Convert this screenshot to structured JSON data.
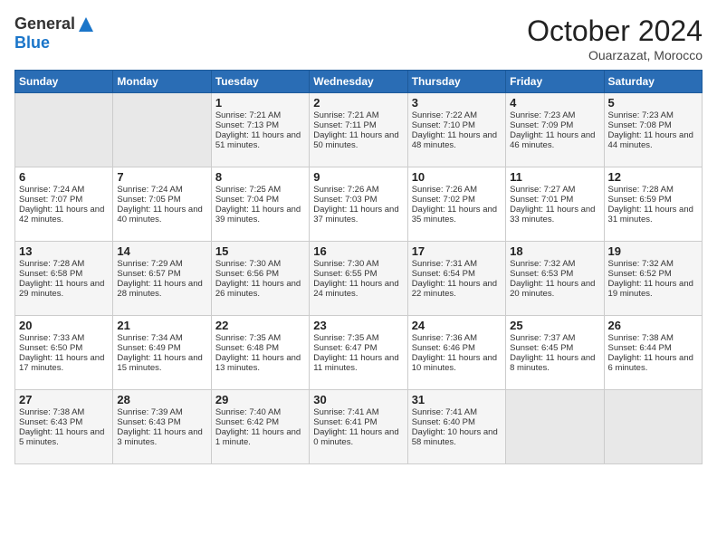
{
  "header": {
    "logo_general": "General",
    "logo_blue": "Blue",
    "month": "October 2024",
    "location": "Ouarzazat, Morocco"
  },
  "weekdays": [
    "Sunday",
    "Monday",
    "Tuesday",
    "Wednesday",
    "Thursday",
    "Friday",
    "Saturday"
  ],
  "weeks": [
    [
      {
        "day": "",
        "sunrise": "",
        "sunset": "",
        "daylight": "",
        "empty": true
      },
      {
        "day": "",
        "sunrise": "",
        "sunset": "",
        "daylight": "",
        "empty": true
      },
      {
        "day": "1",
        "sunrise": "Sunrise: 7:21 AM",
        "sunset": "Sunset: 7:13 PM",
        "daylight": "Daylight: 11 hours and 51 minutes."
      },
      {
        "day": "2",
        "sunrise": "Sunrise: 7:21 AM",
        "sunset": "Sunset: 7:11 PM",
        "daylight": "Daylight: 11 hours and 50 minutes."
      },
      {
        "day": "3",
        "sunrise": "Sunrise: 7:22 AM",
        "sunset": "Sunset: 7:10 PM",
        "daylight": "Daylight: 11 hours and 48 minutes."
      },
      {
        "day": "4",
        "sunrise": "Sunrise: 7:23 AM",
        "sunset": "Sunset: 7:09 PM",
        "daylight": "Daylight: 11 hours and 46 minutes."
      },
      {
        "day": "5",
        "sunrise": "Sunrise: 7:23 AM",
        "sunset": "Sunset: 7:08 PM",
        "daylight": "Daylight: 11 hours and 44 minutes."
      }
    ],
    [
      {
        "day": "6",
        "sunrise": "Sunrise: 7:24 AM",
        "sunset": "Sunset: 7:07 PM",
        "daylight": "Daylight: 11 hours and 42 minutes."
      },
      {
        "day": "7",
        "sunrise": "Sunrise: 7:24 AM",
        "sunset": "Sunset: 7:05 PM",
        "daylight": "Daylight: 11 hours and 40 minutes."
      },
      {
        "day": "8",
        "sunrise": "Sunrise: 7:25 AM",
        "sunset": "Sunset: 7:04 PM",
        "daylight": "Daylight: 11 hours and 39 minutes."
      },
      {
        "day": "9",
        "sunrise": "Sunrise: 7:26 AM",
        "sunset": "Sunset: 7:03 PM",
        "daylight": "Daylight: 11 hours and 37 minutes."
      },
      {
        "day": "10",
        "sunrise": "Sunrise: 7:26 AM",
        "sunset": "Sunset: 7:02 PM",
        "daylight": "Daylight: 11 hours and 35 minutes."
      },
      {
        "day": "11",
        "sunrise": "Sunrise: 7:27 AM",
        "sunset": "Sunset: 7:01 PM",
        "daylight": "Daylight: 11 hours and 33 minutes."
      },
      {
        "day": "12",
        "sunrise": "Sunrise: 7:28 AM",
        "sunset": "Sunset: 6:59 PM",
        "daylight": "Daylight: 11 hours and 31 minutes."
      }
    ],
    [
      {
        "day": "13",
        "sunrise": "Sunrise: 7:28 AM",
        "sunset": "Sunset: 6:58 PM",
        "daylight": "Daylight: 11 hours and 29 minutes."
      },
      {
        "day": "14",
        "sunrise": "Sunrise: 7:29 AM",
        "sunset": "Sunset: 6:57 PM",
        "daylight": "Daylight: 11 hours and 28 minutes."
      },
      {
        "day": "15",
        "sunrise": "Sunrise: 7:30 AM",
        "sunset": "Sunset: 6:56 PM",
        "daylight": "Daylight: 11 hours and 26 minutes."
      },
      {
        "day": "16",
        "sunrise": "Sunrise: 7:30 AM",
        "sunset": "Sunset: 6:55 PM",
        "daylight": "Daylight: 11 hours and 24 minutes."
      },
      {
        "day": "17",
        "sunrise": "Sunrise: 7:31 AM",
        "sunset": "Sunset: 6:54 PM",
        "daylight": "Daylight: 11 hours and 22 minutes."
      },
      {
        "day": "18",
        "sunrise": "Sunrise: 7:32 AM",
        "sunset": "Sunset: 6:53 PM",
        "daylight": "Daylight: 11 hours and 20 minutes."
      },
      {
        "day": "19",
        "sunrise": "Sunrise: 7:32 AM",
        "sunset": "Sunset: 6:52 PM",
        "daylight": "Daylight: 11 hours and 19 minutes."
      }
    ],
    [
      {
        "day": "20",
        "sunrise": "Sunrise: 7:33 AM",
        "sunset": "Sunset: 6:50 PM",
        "daylight": "Daylight: 11 hours and 17 minutes."
      },
      {
        "day": "21",
        "sunrise": "Sunrise: 7:34 AM",
        "sunset": "Sunset: 6:49 PM",
        "daylight": "Daylight: 11 hours and 15 minutes."
      },
      {
        "day": "22",
        "sunrise": "Sunrise: 7:35 AM",
        "sunset": "Sunset: 6:48 PM",
        "daylight": "Daylight: 11 hours and 13 minutes."
      },
      {
        "day": "23",
        "sunrise": "Sunrise: 7:35 AM",
        "sunset": "Sunset: 6:47 PM",
        "daylight": "Daylight: 11 hours and 11 minutes."
      },
      {
        "day": "24",
        "sunrise": "Sunrise: 7:36 AM",
        "sunset": "Sunset: 6:46 PM",
        "daylight": "Daylight: 11 hours and 10 minutes."
      },
      {
        "day": "25",
        "sunrise": "Sunrise: 7:37 AM",
        "sunset": "Sunset: 6:45 PM",
        "daylight": "Daylight: 11 hours and 8 minutes."
      },
      {
        "day": "26",
        "sunrise": "Sunrise: 7:38 AM",
        "sunset": "Sunset: 6:44 PM",
        "daylight": "Daylight: 11 hours and 6 minutes."
      }
    ],
    [
      {
        "day": "27",
        "sunrise": "Sunrise: 7:38 AM",
        "sunset": "Sunset: 6:43 PM",
        "daylight": "Daylight: 11 hours and 5 minutes."
      },
      {
        "day": "28",
        "sunrise": "Sunrise: 7:39 AM",
        "sunset": "Sunset: 6:43 PM",
        "daylight": "Daylight: 11 hours and 3 minutes."
      },
      {
        "day": "29",
        "sunrise": "Sunrise: 7:40 AM",
        "sunset": "Sunset: 6:42 PM",
        "daylight": "Daylight: 11 hours and 1 minute."
      },
      {
        "day": "30",
        "sunrise": "Sunrise: 7:41 AM",
        "sunset": "Sunset: 6:41 PM",
        "daylight": "Daylight: 11 hours and 0 minutes."
      },
      {
        "day": "31",
        "sunrise": "Sunrise: 7:41 AM",
        "sunset": "Sunset: 6:40 PM",
        "daylight": "Daylight: 10 hours and 58 minutes."
      },
      {
        "day": "",
        "sunrise": "",
        "sunset": "",
        "daylight": "",
        "empty": true
      },
      {
        "day": "",
        "sunrise": "",
        "sunset": "",
        "daylight": "",
        "empty": true
      }
    ]
  ]
}
